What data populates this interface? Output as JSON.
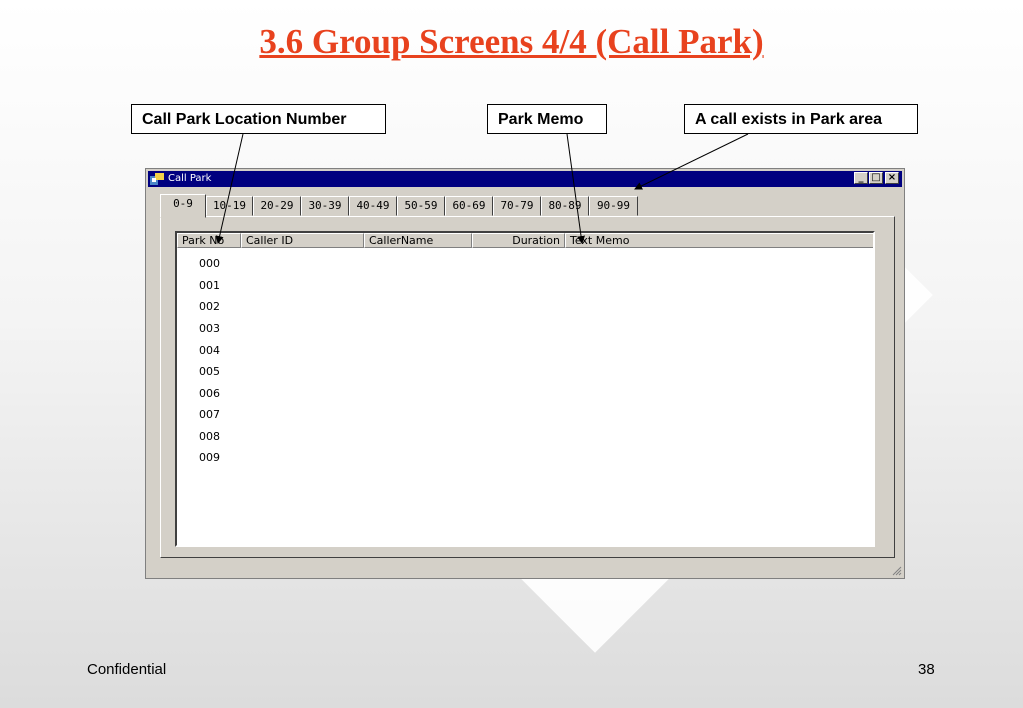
{
  "slide": {
    "title": "3.6 Group Screens 4/4 (Call Park)",
    "footer_left": "Confidential",
    "page_number": "38",
    "title_color": "#e8421e"
  },
  "callouts": {
    "location_number": "Call Park Location Number",
    "park_memo": "Park Memo",
    "call_exists": "A call exists in Park area"
  },
  "window": {
    "title": "Call Park",
    "titlebar_color": "#000080",
    "tabs": [
      "0-9",
      "10-19",
      "20-29",
      "30-39",
      "40-49",
      "50-59",
      "60-69",
      "70-79",
      "80-89",
      "90-99"
    ],
    "active_tab": "0-9",
    "columns": {
      "park_no": "Park No",
      "caller_id": "Caller ID",
      "caller_name": "CallerName",
      "duration": "Duration",
      "text_memo": "Text Memo"
    },
    "rows": [
      "000",
      "001",
      "002",
      "003",
      "004",
      "005",
      "006",
      "007",
      "008",
      "009"
    ]
  }
}
